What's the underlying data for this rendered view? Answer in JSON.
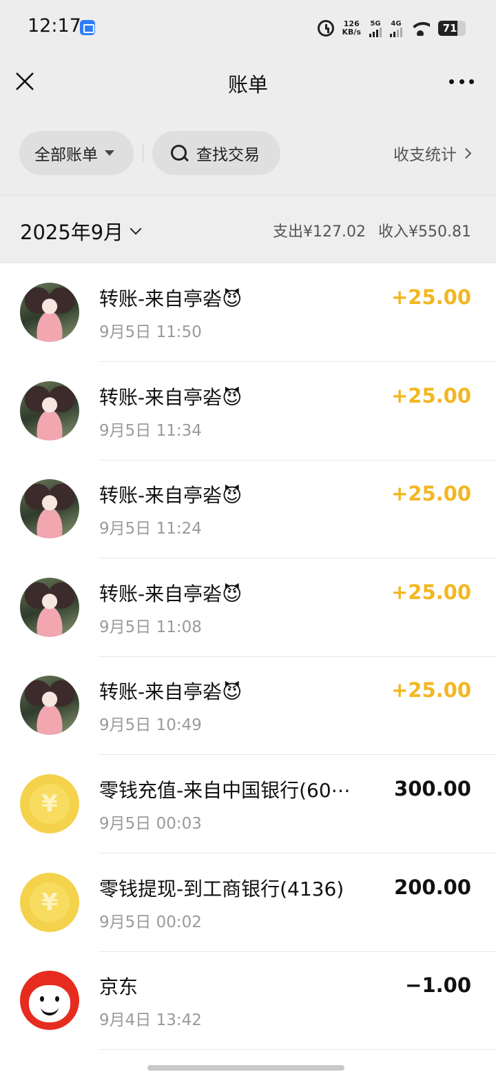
{
  "status_bar": {
    "time": "12:17",
    "net_speed_value": "126",
    "net_speed_unit": "KB/s",
    "signal1": "5G",
    "signal2": "4G",
    "battery": "71"
  },
  "nav": {
    "title": "账单",
    "close_icon": "close-icon",
    "more_icon": "more-icon"
  },
  "filters": {
    "all_bills": "全部账单",
    "search": "查找交易",
    "stats": "收支统计"
  },
  "month": {
    "label": "2025年9月",
    "expense": "支出¥127.02",
    "income": "收入¥550.81"
  },
  "transactions": [
    {
      "title": "转账-来自亭沯😈",
      "time": "9月5日 11:50",
      "amount": "+25.00",
      "type": "income",
      "avatar": "anime"
    },
    {
      "title": "转账-来自亭沯😈",
      "time": "9月5日 11:34",
      "amount": "+25.00",
      "type": "income",
      "avatar": "anime"
    },
    {
      "title": "转账-来自亭沯😈",
      "time": "9月5日 11:24",
      "amount": "+25.00",
      "type": "income",
      "avatar": "anime"
    },
    {
      "title": "转账-来自亭沯😈",
      "time": "9月5日 11:08",
      "amount": "+25.00",
      "type": "income",
      "avatar": "anime"
    },
    {
      "title": "转账-来自亭沯😈",
      "time": "9月5日 10:49",
      "amount": "+25.00",
      "type": "income",
      "avatar": "anime"
    },
    {
      "title": "零钱充值-来自中国银行(60⋯",
      "time": "9月5日 00:03",
      "amount": "300.00",
      "type": "neutral",
      "avatar": "coin"
    },
    {
      "title": "零钱提现-到工商银行(4136)",
      "time": "9月5日 00:02",
      "amount": "200.00",
      "type": "neutral",
      "avatar": "coin"
    },
    {
      "title": "京东",
      "time": "9月4日 13:42",
      "amount": "−1.00",
      "type": "expense",
      "avatar": "jd"
    }
  ],
  "colors": {
    "income": "#f2b722",
    "background": "#ededed"
  },
  "coin_symbol": "¥"
}
